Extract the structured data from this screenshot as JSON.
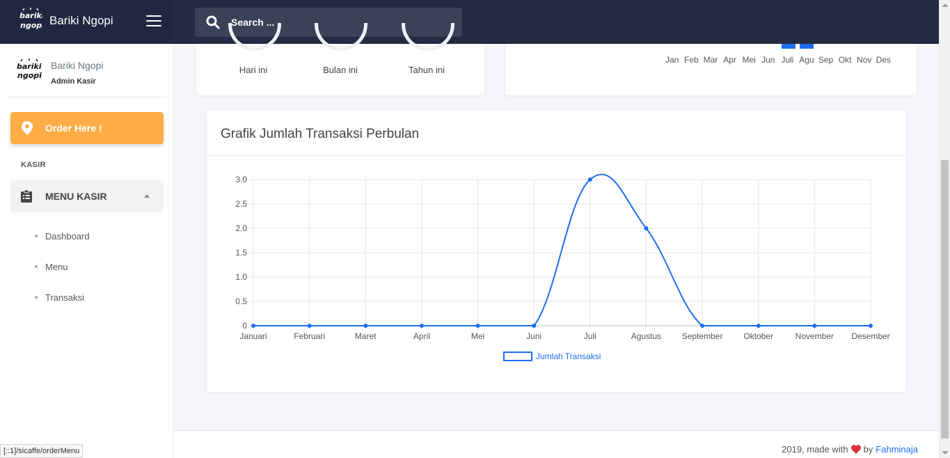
{
  "brand": {
    "name": "Bariki Ngopi",
    "logo_text": "bariki ngopi"
  },
  "search": {
    "placeholder": "Search ..."
  },
  "user": {
    "name": "Bariki Ngopi",
    "role": "Admin Kasir"
  },
  "sidebar": {
    "order_label": "Order Here !",
    "section_label": "KASIR",
    "menu_label": "MENU KASIR",
    "items": [
      {
        "label": "Dashboard"
      },
      {
        "label": "Menu"
      },
      {
        "label": "Transaksi"
      }
    ]
  },
  "stats": {
    "labels": [
      "Hari ini",
      "Bulan ini",
      "Tahun ini"
    ]
  },
  "months_card": {
    "labels": [
      "Jan",
      "Feb",
      "Mar",
      "Apr",
      "Mei",
      "Jun",
      "Juli",
      "Agu",
      "Sep",
      "Okt",
      "Nov",
      "Des"
    ],
    "bar_color": "#1d6ef0"
  },
  "chart_title": "Grafik Jumlah Transaksi Perbulan",
  "chart_data": {
    "type": "line",
    "categories": [
      "Januari",
      "Februari",
      "Maret",
      "April",
      "Mei",
      "Juni",
      "Juli",
      "Agustus",
      "September",
      "Oktober",
      "November",
      "Desember"
    ],
    "series": [
      {
        "name": "Jumlah Transaksi",
        "values": [
          0,
          0,
          0,
          0,
          0,
          0,
          3,
          2,
          0,
          0,
          0,
          0
        ],
        "color": "#1d6ef0"
      }
    ],
    "ylim": [
      0,
      3
    ],
    "yticks": [
      "0",
      "0.5",
      "1.0",
      "1.5",
      "2.0",
      "2.5",
      "3.0"
    ],
    "grid": true,
    "legend": "bottom"
  },
  "footer": {
    "text": "2019, made with",
    "by": "by",
    "author": "Fahminaja"
  },
  "status_bar": {
    "url": "[::1]/sicaffe/orderMenu"
  },
  "colors": {
    "header": "#1f2840",
    "accent_orange": "#ffad46",
    "accent_blue": "#1d6ef0",
    "heart": "#e2333a"
  }
}
